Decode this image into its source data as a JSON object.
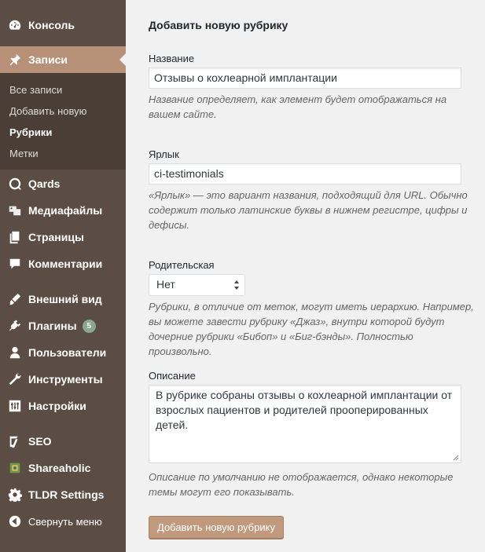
{
  "sidebar": {
    "items": [
      {
        "label": "Консоль",
        "icon": "dashboard-icon"
      },
      {
        "label": "Записи",
        "icon": "pin-icon"
      },
      {
        "label": "Qards",
        "icon": "qards-icon"
      },
      {
        "label": "Медиафайлы",
        "icon": "media-icon"
      },
      {
        "label": "Страницы",
        "icon": "pages-icon"
      },
      {
        "label": "Комментарии",
        "icon": "comments-icon"
      },
      {
        "label": "Внешний вид",
        "icon": "appearance-icon"
      },
      {
        "label": "Плагины",
        "icon": "plugins-icon",
        "badge": "5"
      },
      {
        "label": "Пользователи",
        "icon": "users-icon"
      },
      {
        "label": "Инструменты",
        "icon": "tools-icon"
      },
      {
        "label": "Настройки",
        "icon": "settings-icon"
      },
      {
        "label": "SEO",
        "icon": "seo-icon"
      },
      {
        "label": "Shareaholic",
        "icon": "shareaholic-icon"
      },
      {
        "label": "TLDR Settings",
        "icon": "gear-icon"
      },
      {
        "label": "Свернуть меню",
        "icon": "collapse-icon"
      }
    ],
    "submenu": [
      {
        "label": "Все записи"
      },
      {
        "label": "Добавить новую"
      },
      {
        "label": "Рубрики"
      },
      {
        "label": "Метки"
      }
    ]
  },
  "form": {
    "title": "Добавить новую рубрику",
    "name_label": "Название",
    "name_value": "Отзывы о кохлеарной имплантации",
    "name_desc": "Название определяет, как элемент будет отображаться на вашем сайте.",
    "slug_label": "Ярлык",
    "slug_value": "ci-testimonials",
    "slug_desc": "«Ярлык» — это вариант названия, подходящий для URL. Обычно содержит только латинские буквы в нижнем регистре, цифры и дефисы.",
    "parent_label": "Родительская",
    "parent_value": "Нет",
    "parent_desc": "Рубрики, в отличие от меток, могут иметь иерархию. Например, вы можете завести рубрику «Джаз», внутри которой будут дочерние рубрики «Бибоп» и «Биг-бэнды». Полностью произвольно.",
    "description_label": "Описание",
    "description_value": "В рубрике собраны отзывы о кохлеарной имплантации от взрослых пациентов и родителей прооперированных детей.",
    "description_desc": "Описание по умолчанию не отображается, однако некоторые темы могут его показывать.",
    "submit_label": "Добавить новую рубрику"
  },
  "colors": {
    "sidebar_bg": "#5b4d43",
    "submenu_bg": "#4a3e36",
    "active_bg": "#b69177",
    "button_bg": "#c19a7e",
    "badge_bg": "#8aa88b"
  }
}
